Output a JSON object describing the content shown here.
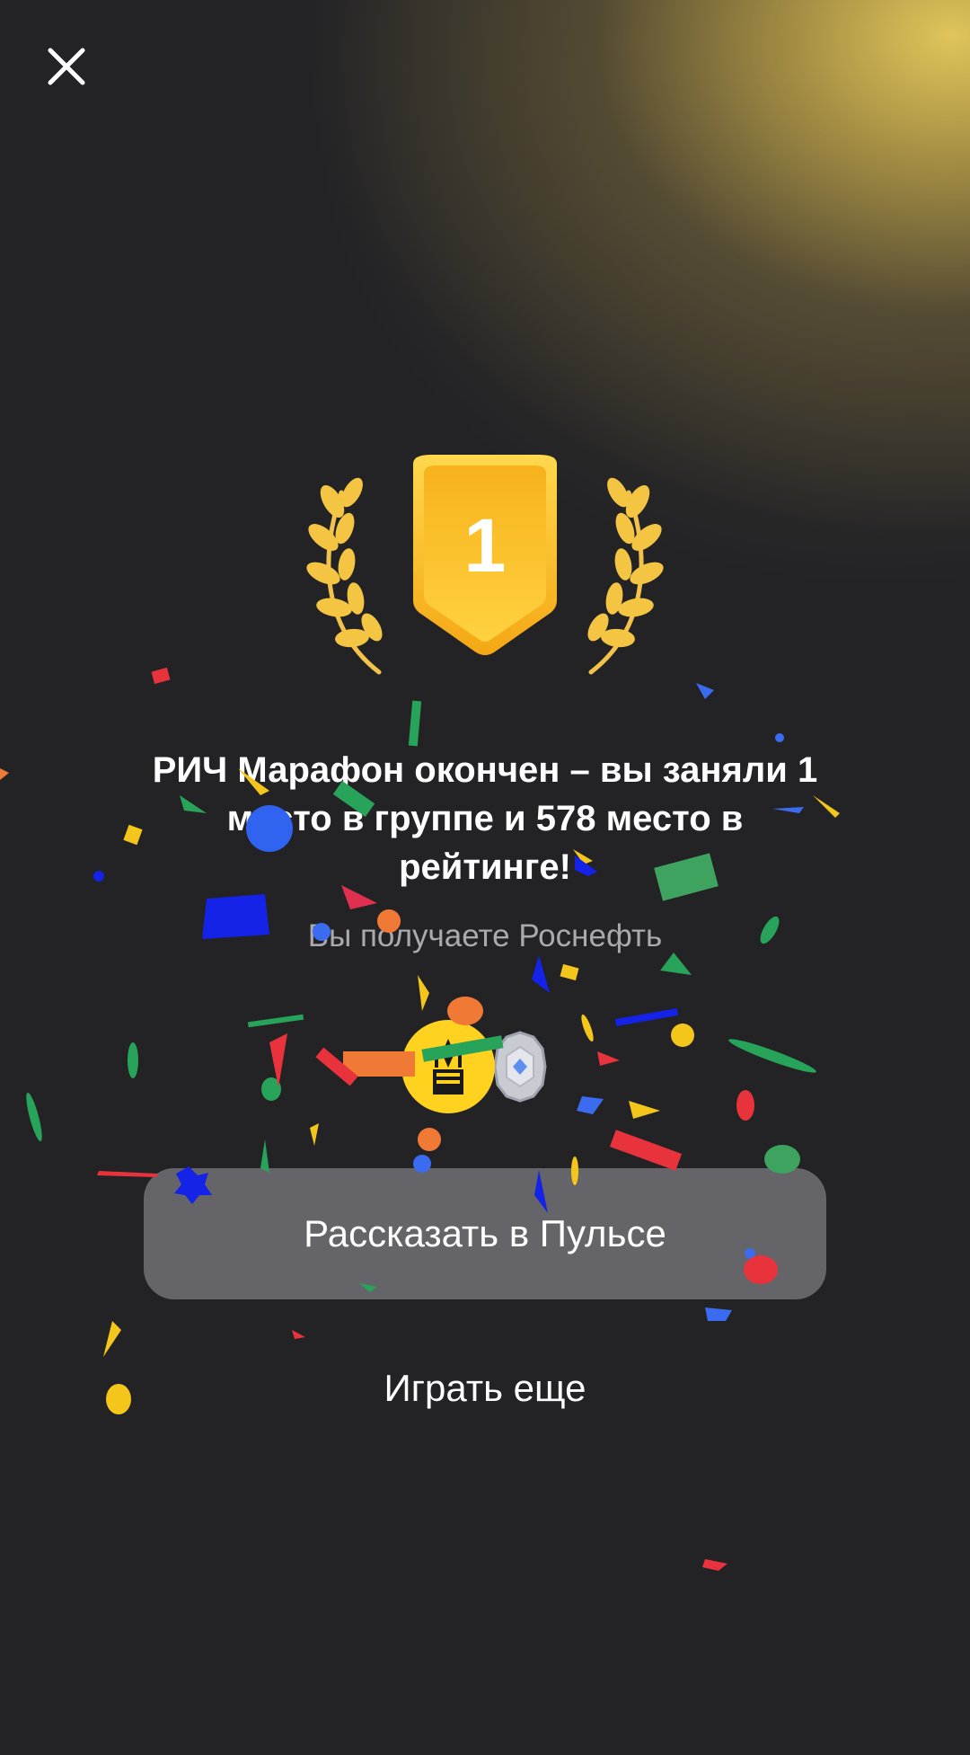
{
  "header": {
    "close_icon": "close-icon"
  },
  "badge": {
    "place": "1",
    "icon": "laurel-wreath-icon"
  },
  "result": {
    "headline": "РИЧ Марафон окончен – вы заняли 1 место в группе и 578 место в рейтинге!",
    "subtitle": "Вы получаете Роснефть"
  },
  "rewards": {
    "stock_icon": "rosneft-logo-icon",
    "bonus_icon": "silver-gem-badge-icon"
  },
  "actions": {
    "share_label": "Рассказать в Пульсе",
    "play_again_label": "Играть еще"
  },
  "colors": {
    "accent_gold": "#F6B21A",
    "background": "#232326",
    "button_bg": "#78787C"
  }
}
